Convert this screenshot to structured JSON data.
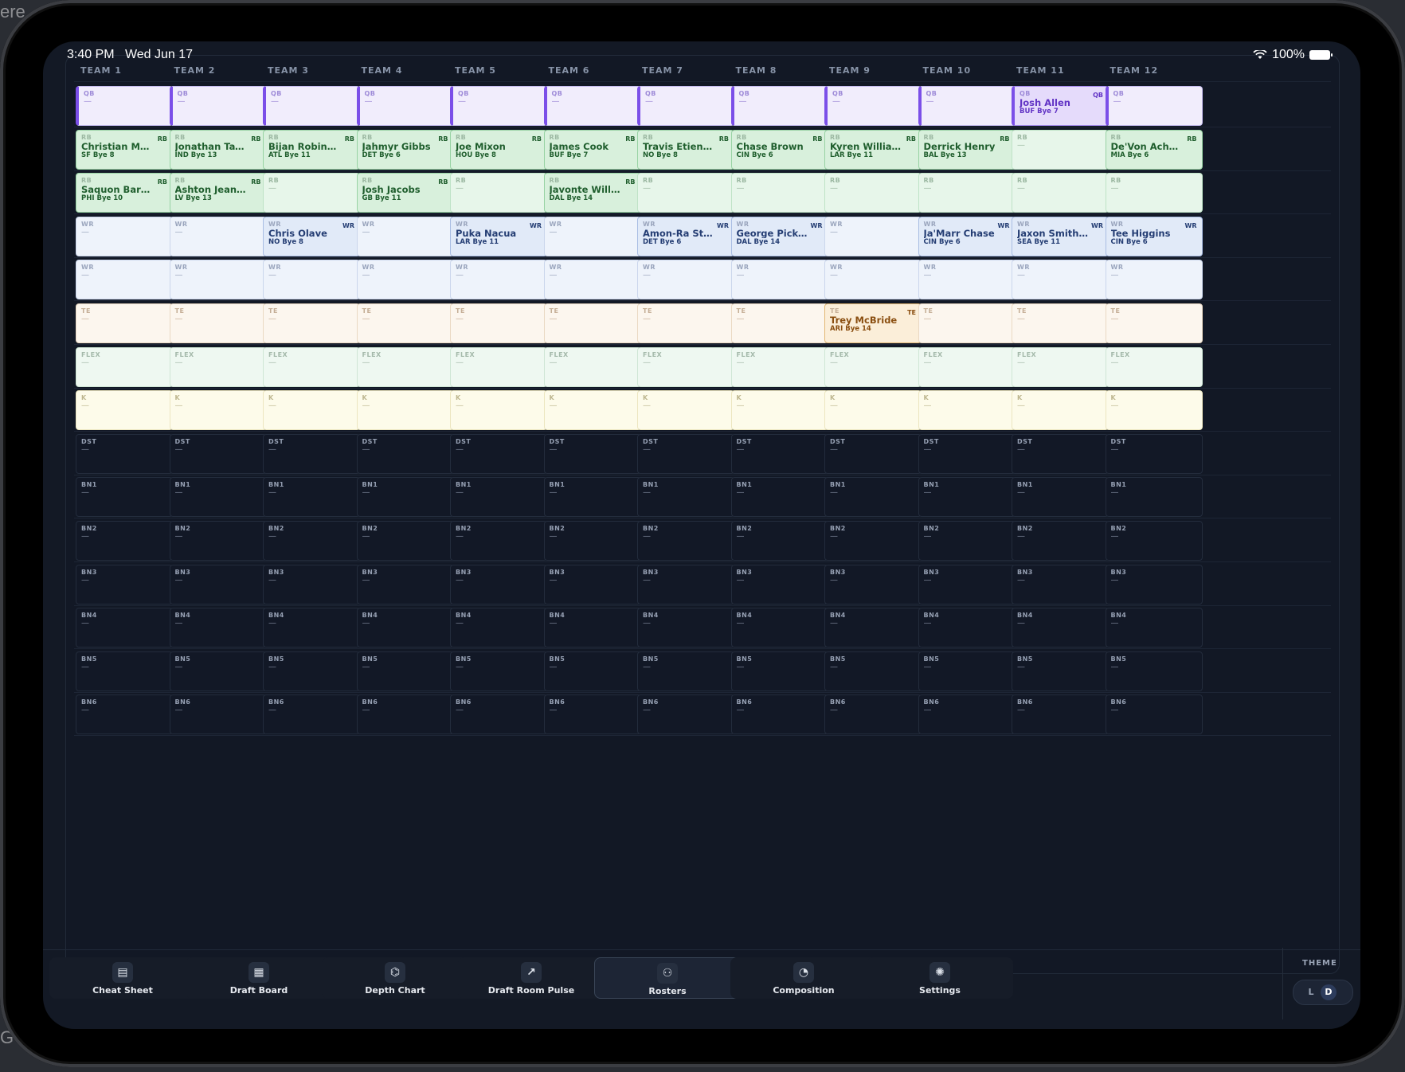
{
  "status": {
    "time": "3:40 PM",
    "date": "Wed Jun 17",
    "battery": "100%"
  },
  "corner": {
    "top_left": "ere",
    "bottom_left": "G"
  },
  "teams": [
    "TEAM 1",
    "TEAM 2",
    "TEAM 3",
    "TEAM 4",
    "TEAM 5",
    "TEAM 6",
    "TEAM 7",
    "TEAM 8",
    "TEAM 9",
    "TEAM 10",
    "TEAM 11",
    "TEAM 12"
  ],
  "rows": [
    {
      "label": "QB",
      "kind": "QB"
    },
    {
      "label": "RB",
      "kind": "RB"
    },
    {
      "label": "RB",
      "kind": "RB"
    },
    {
      "label": "WR",
      "kind": "WR"
    },
    {
      "label": "WR",
      "kind": "WR"
    },
    {
      "label": "TE",
      "kind": "TE"
    },
    {
      "label": "FLEX",
      "kind": "FLEX"
    },
    {
      "label": "K",
      "kind": "K"
    },
    {
      "label": "DST",
      "kind": "DARK"
    },
    {
      "label": "BN1",
      "kind": "DARK"
    },
    {
      "label": "BN2",
      "kind": "DARK"
    },
    {
      "label": "BN3",
      "kind": "DARK"
    },
    {
      "label": "BN4",
      "kind": "DARK"
    },
    {
      "label": "BN5",
      "kind": "DARK"
    },
    {
      "label": "BN6",
      "kind": "DARK"
    }
  ],
  "empty_value": "—",
  "picks": [
    {
      "row": 0,
      "team": 10,
      "name": "Josh Allen",
      "meta": "BUF Bye 7",
      "pos": "QB"
    },
    {
      "row": 1,
      "team": 0,
      "name": "Christian McCaffrey",
      "meta": "SF Bye 8",
      "pos": "RB"
    },
    {
      "row": 1,
      "team": 1,
      "name": "Jonathan Taylor",
      "meta": "IND Bye 13",
      "pos": "RB"
    },
    {
      "row": 1,
      "team": 2,
      "name": "Bijan Robinson",
      "meta": "ATL Bye 11",
      "pos": "RB"
    },
    {
      "row": 1,
      "team": 3,
      "name": "Jahmyr Gibbs",
      "meta": "DET Bye 6",
      "pos": "RB"
    },
    {
      "row": 1,
      "team": 4,
      "name": "Joe Mixon",
      "meta": "HOU Bye 8",
      "pos": "RB"
    },
    {
      "row": 1,
      "team": 5,
      "name": "James Cook",
      "meta": "BUF Bye 7",
      "pos": "RB"
    },
    {
      "row": 1,
      "team": 6,
      "name": "Travis Etienne",
      "meta": "NO Bye 8",
      "pos": "RB"
    },
    {
      "row": 1,
      "team": 7,
      "name": "Chase Brown",
      "meta": "CIN Bye 6",
      "pos": "RB"
    },
    {
      "row": 1,
      "team": 8,
      "name": "Kyren Williams",
      "meta": "LAR Bye 11",
      "pos": "RB"
    },
    {
      "row": 1,
      "team": 9,
      "name": "Derrick Henry",
      "meta": "BAL Bye 13",
      "pos": "RB"
    },
    {
      "row": 1,
      "team": 11,
      "name": "De'Von Achane",
      "meta": "MIA Bye 6",
      "pos": "RB"
    },
    {
      "row": 2,
      "team": 0,
      "name": "Saquon Barkley",
      "meta": "PHI Bye 10",
      "pos": "RB"
    },
    {
      "row": 2,
      "team": 1,
      "name": "Ashton Jeanty",
      "meta": "LV Bye 13",
      "pos": "RB"
    },
    {
      "row": 2,
      "team": 3,
      "name": "Josh Jacobs",
      "meta": "GB Bye 11",
      "pos": "RB"
    },
    {
      "row": 2,
      "team": 5,
      "name": "Javonte Williams",
      "meta": "DAL Bye 14",
      "pos": "RB"
    },
    {
      "row": 3,
      "team": 2,
      "name": "Chris Olave",
      "meta": "NO Bye 8",
      "pos": "WR"
    },
    {
      "row": 3,
      "team": 4,
      "name": "Puka Nacua",
      "meta": "LAR Bye 11",
      "pos": "WR"
    },
    {
      "row": 3,
      "team": 6,
      "name": "Amon-Ra St. Brown",
      "meta": "DET Bye 6",
      "pos": "WR"
    },
    {
      "row": 3,
      "team": 7,
      "name": "George Pickens",
      "meta": "DAL Bye 14",
      "pos": "WR"
    },
    {
      "row": 3,
      "team": 9,
      "name": "Ja'Marr Chase",
      "meta": "CIN Bye 6",
      "pos": "WR"
    },
    {
      "row": 3,
      "team": 10,
      "name": "Jaxon Smith-Njigba",
      "meta": "SEA Bye 11",
      "pos": "WR"
    },
    {
      "row": 3,
      "team": 11,
      "name": "Tee Higgins",
      "meta": "CIN Bye 6",
      "pos": "WR"
    },
    {
      "row": 5,
      "team": 8,
      "name": "Trey McBride",
      "meta": "ARI Bye 14",
      "pos": "TE"
    }
  ],
  "nav": [
    {
      "label": "Cheat Sheet",
      "icon": "document-icon",
      "glyph": "▤",
      "active": false
    },
    {
      "label": "Draft Board",
      "icon": "grid-icon",
      "glyph": "▦",
      "active": false
    },
    {
      "label": "Depth Chart",
      "icon": "hierarchy-icon",
      "glyph": "⌬",
      "active": false
    },
    {
      "label": "Draft Room Pulse",
      "icon": "trend-icon",
      "glyph": "↗",
      "active": false
    },
    {
      "label": "Rosters",
      "icon": "users-icon",
      "glyph": "⚇",
      "active": true
    },
    {
      "label": "Composition",
      "icon": "pie-icon",
      "glyph": "◔",
      "active": false
    },
    {
      "label": "Settings",
      "icon": "gear-icon",
      "glyph": "✺",
      "active": false
    }
  ],
  "theme": {
    "label": "THEME",
    "light": "L",
    "dark": "D",
    "selected": "D"
  }
}
